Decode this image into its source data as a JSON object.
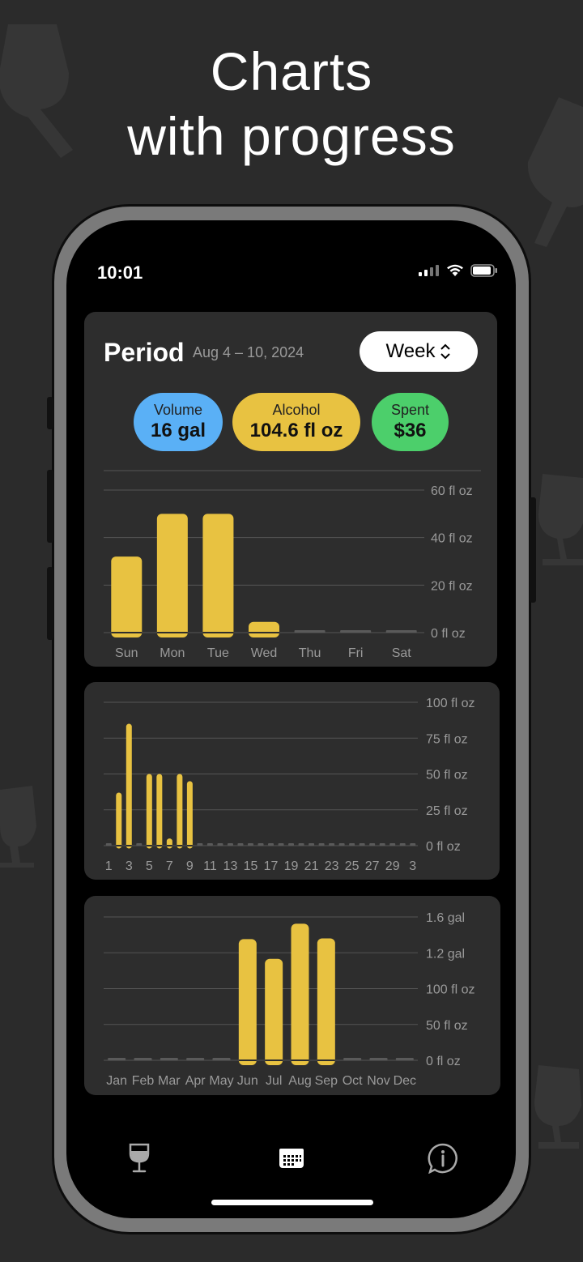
{
  "headline": {
    "line1": "Charts",
    "line2": "with progress"
  },
  "status": {
    "time": "10:01"
  },
  "period": {
    "title": "Period",
    "range": "Aug 4 – 10, 2024",
    "select_label": "Week"
  },
  "stats": [
    {
      "label": "Volume",
      "value": "16 gal",
      "color": "#5ab0f6"
    },
    {
      "label": "Alcohol",
      "value": "104.6 fl oz",
      "color": "#e8c241"
    },
    {
      "label": "Spent",
      "value": "$36",
      "color": "#4ccf6b"
    }
  ],
  "colors": {
    "bar": "#e8c241",
    "empty_bar": "#5a5a5a",
    "grid": "#555555",
    "tick": "#9a9a9a"
  },
  "chart_data": [
    {
      "type": "bar",
      "categories": [
        "Sun",
        "Mon",
        "Tue",
        "Wed",
        "Thu",
        "Fri",
        "Sat"
      ],
      "values": [
        32,
        50,
        50,
        4.5,
        0,
        0,
        0
      ],
      "y_ticks": [
        "0 fl oz",
        "20 fl oz",
        "40 fl oz",
        "60 fl oz"
      ],
      "ylim": [
        0,
        60
      ]
    },
    {
      "type": "bar",
      "categories": [
        "1",
        "2",
        "3",
        "4",
        "5",
        "6",
        "7",
        "8",
        "9",
        "10",
        "11",
        "12",
        "13",
        "14",
        "15",
        "16",
        "17",
        "18",
        "19",
        "20",
        "21",
        "22",
        "23",
        "24",
        "25",
        "26",
        "27",
        "28",
        "29",
        "30",
        "31"
      ],
      "x_tick_labels": [
        "1",
        "3",
        "5",
        "7",
        "9",
        "11",
        "13",
        "15",
        "17",
        "19",
        "21",
        "23",
        "25",
        "27",
        "29",
        "3"
      ],
      "values": [
        0,
        37,
        85,
        0,
        50,
        50,
        5,
        50,
        45,
        0,
        0,
        0,
        0,
        0,
        0,
        0,
        0,
        0,
        0,
        0,
        0,
        0,
        0,
        0,
        0,
        0,
        0,
        0,
        0,
        0,
        0
      ],
      "y_ticks": [
        "0 fl oz",
        "25 fl oz",
        "50 fl oz",
        "75 fl oz",
        "100 fl oz"
      ],
      "ylim": [
        0,
        100
      ]
    },
    {
      "type": "bar",
      "categories": [
        "Jan",
        "Feb",
        "Mar",
        "Apr",
        "May",
        "Jun",
        "Jul",
        "Aug",
        "Sep",
        "Oct",
        "Nov",
        "Dec"
      ],
      "values": [
        0,
        0,
        0,
        0,
        0,
        3.38,
        2.83,
        3.81,
        3.4,
        0,
        0,
        0
      ],
      "y_ticks": [
        "0 fl oz",
        "50 fl oz",
        "100 fl oz",
        "1.2 gal",
        "1.6 gal"
      ],
      "ylim": [
        0,
        4
      ]
    }
  ],
  "tabs": [
    {
      "icon": "wine-glass-icon"
    },
    {
      "icon": "calendar-icon"
    },
    {
      "icon": "info-bubble-icon"
    }
  ]
}
